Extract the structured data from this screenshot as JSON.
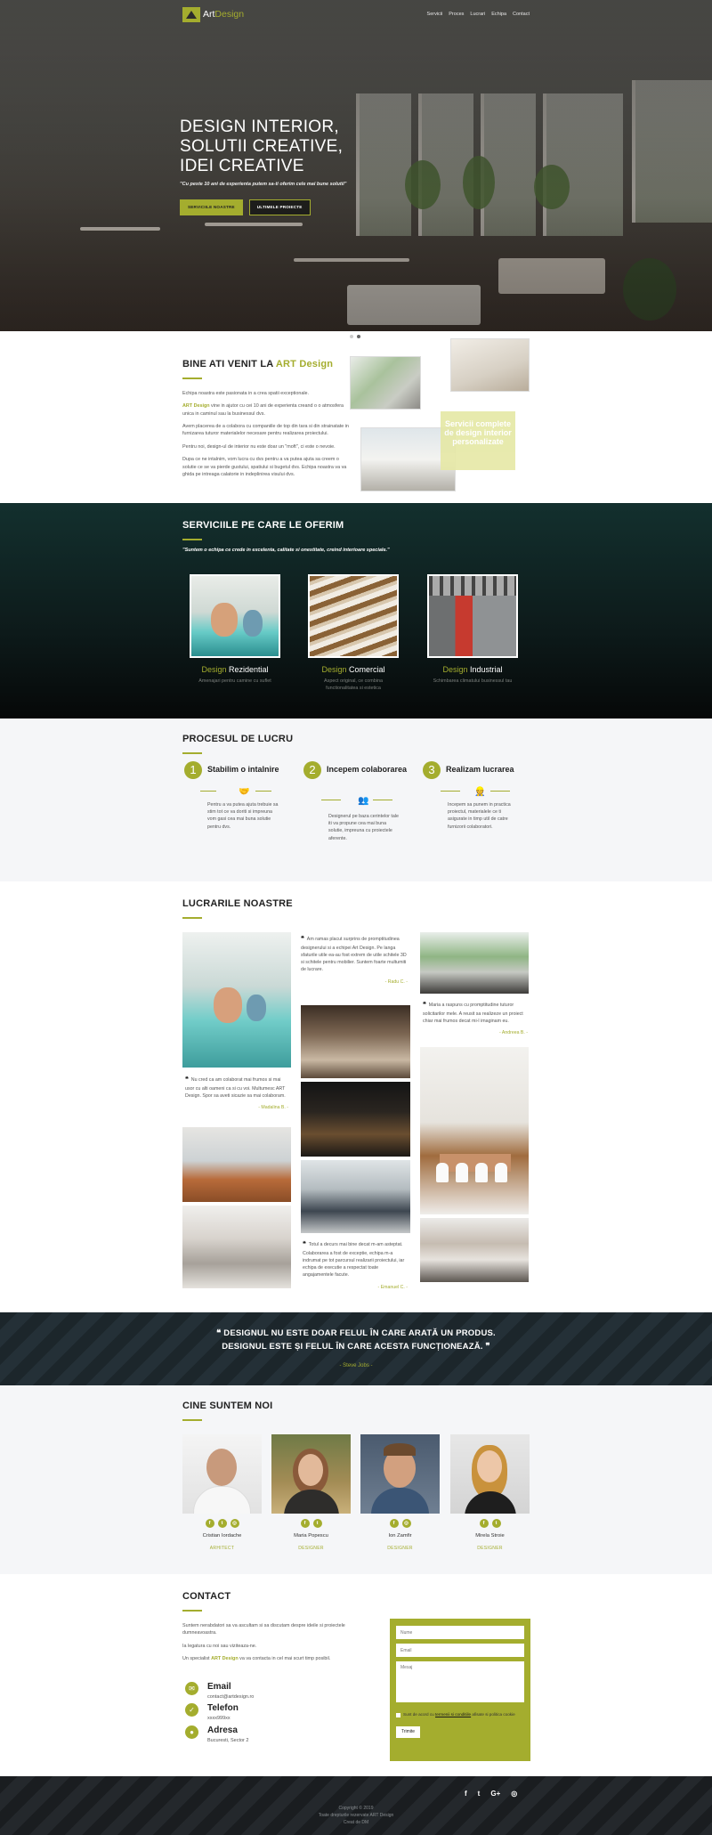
{
  "nav": {
    "logo_art": "Art",
    "logo_design": "Design",
    "menu": [
      "Servicii",
      "Proces",
      "Lucrari",
      "Echipa",
      "Contact"
    ]
  },
  "hero": {
    "line1": "DESIGN INTERIOR,",
    "line2": "SOLUTII CREATIVE,",
    "line3": "IDEI CREATIVE",
    "subtitle": "\"Cu peste 10 ani de experienta putem sa-ti oferim cele mai bune solutii\"",
    "btn_services": "SERVICIILE NOASTRE",
    "btn_projects": "ULTIMELE PROIECTE",
    "active_slide": 2,
    "slides": 2
  },
  "welcome": {
    "title_prefix": "BINE ATI VENIT LA",
    "title_brand": "ART Design",
    "p1": "Echipa noastra este pasionata in a crea spatii exceptionale.",
    "p2_brand": "ART Design",
    "p2_rest": " vine in ajutor cu cei 10 ani de experienta creand o o atmosfera unica in caminul sau la businessul dvs.",
    "p3": "Avem placerea de a colabora cu companiile de top din tara si din strainatate in furnizarea tuturor materialelor necesare pentru realizarea proiectului.",
    "p4": "Pentru noi, design-ul de interior nu este doar un \"moft\", ci este o nevoie.",
    "p5": "Dupa ce ne intalnim, vom lucra cu dvs pentru a va putea ajuta sa creem o solutie ce se va pierde gustului, spatiului si bugetul dvs. Echipa noastra va va ghida pe intreaga calatorie in indeplinirea visului dvs.",
    "box_text": "Servicii complete de design interior personalizate"
  },
  "services": {
    "title": "SERVICIILE PE CARE LE OFERIM",
    "subtitle": "\"Suntem o echipa ce crede in excelenta, calitate si onestitate, creind interioare speciale.\"",
    "items": [
      {
        "word1": "Design",
        "word2": "Rezidential",
        "desc": "Amenajari pentru camine cu suflet"
      },
      {
        "word1": "Design",
        "word2": "Comercial",
        "desc": "Aspect original, ce combina functionalitatea si estetica"
      },
      {
        "word1": "Design",
        "word2": "Industrial",
        "desc": "Schimbarea climatului businessul tau"
      }
    ]
  },
  "process": {
    "title": "PROCESUL DE LUCRU",
    "steps": [
      {
        "num": "1",
        "title": "Stabilim o intalnire",
        "desc": "Pentru a va putea ajuta trebuie sa stim tot ce va doriti si impreuna vom gasi cea mai buna solutie pentru dvs."
      },
      {
        "num": "2",
        "title": "Incepem colaborarea",
        "desc": "Designerul pe baza cerintelor tale iti va propune cea mai buna solutie, impreuna cu proiectele aferente."
      },
      {
        "num": "3",
        "title": "Realizam lucrarea",
        "desc": "Incepem sa punem in practica proiectul, materialele ce ti asigurate in timp util de catre furnizorii colaboratori."
      }
    ]
  },
  "works": {
    "title": "LUCRARILE NOASTRE",
    "quotes": [
      {
        "text": "Am ramas placut surprins de promptitudinea designerului si a echipei Art Design. Pe langa sfaturile utile ea-au fost extrem de utile schitele 3D si schitele pentru mobilier. Suntem foarte multumiti de lucrare.",
        "author": "- Radu C. -"
      },
      {
        "text": "Maria a raspuns cu promptitudine tuturor solicitarilor mele. A reusit sa realizeze un proiect chiar mai frumos decat mi-l imaginam eu.",
        "author": "- Andreea B. -"
      },
      {
        "text": "Nu cred ca am colaborat mai frumos si mai usor cu alti oameni ca si cu voi. Multumesc ART Design. Spor sa aveti sicazie sa mai colaboram.",
        "author": "- Madalina B. -"
      },
      {
        "text": "Totul a decurs mai bine decat m-am asteptat. Colaborarea a fost de exceptie, echipa m-a indrumat pe tot parcursul realizarii proiectului, iar echipa de executie a respectat toate angajamentele facute.",
        "author": "- Emanuel C. -"
      }
    ]
  },
  "banner": {
    "line1": "DESIGNUL NU ESTE DOAR FELUL ÎN CARE ARATĂ UN PRODUS.",
    "line2": "DESIGNUL ESTE ȘI FELUL ÎN CARE ACESTA FUNCȚIONEAZĂ.",
    "author": "- Steve Jobs -"
  },
  "team": {
    "title": "CINE SUNTEM NOI",
    "members": [
      {
        "name": "Cristian Iordache",
        "role": "ARHITECT",
        "socials": [
          "f",
          "t",
          "◎"
        ]
      },
      {
        "name": "Maria Popescu",
        "role": "DESIGNER",
        "socials": [
          "f",
          "t"
        ]
      },
      {
        "name": "Ion Zamfir",
        "role": "DESIGNER",
        "socials": [
          "f",
          "◎"
        ]
      },
      {
        "name": "Mirela Stroie",
        "role": "DESIGNER",
        "socials": [
          "f",
          "t"
        ]
      }
    ]
  },
  "contact": {
    "title": "CONTACT",
    "p1": "Suntem nerabdatori sa va ascultam si sa discutam despre ideile si proiectele dumneavoastra.",
    "p2": "Ia legatura cu noi sau viziteaza-ne.",
    "p3_before": "Un specialist ",
    "p3_brand": "ART Design",
    "p3_after": " va va contacta in cel mai scurt timp posibil.",
    "email_label": "Email",
    "email_value": "contact@artdesign.ro",
    "phone_label": "Telefon",
    "phone_value": "xxxx999xx",
    "address_label": "Adresa",
    "address_value": "Bucuresti, Sector 2",
    "form": {
      "name_placeholder": "Nume",
      "email_placeholder": "Email",
      "message_placeholder": "Mesaj",
      "agree_before": "Sunt de acord cu ",
      "agree_link": "termenii si conditiile",
      "agree_after": " afisate si politica cookie",
      "send": "Trimite"
    }
  },
  "footer": {
    "socials": [
      "f",
      "t",
      "G+",
      "◎"
    ],
    "line1": "Copyright © 2019",
    "line2": "Toate drepturile rezervate ART Design",
    "line3": "Creat de DM"
  },
  "colors": {
    "accent": "#a4ad2e",
    "dark_teal": "#13302e",
    "banner": "#1c262b"
  }
}
